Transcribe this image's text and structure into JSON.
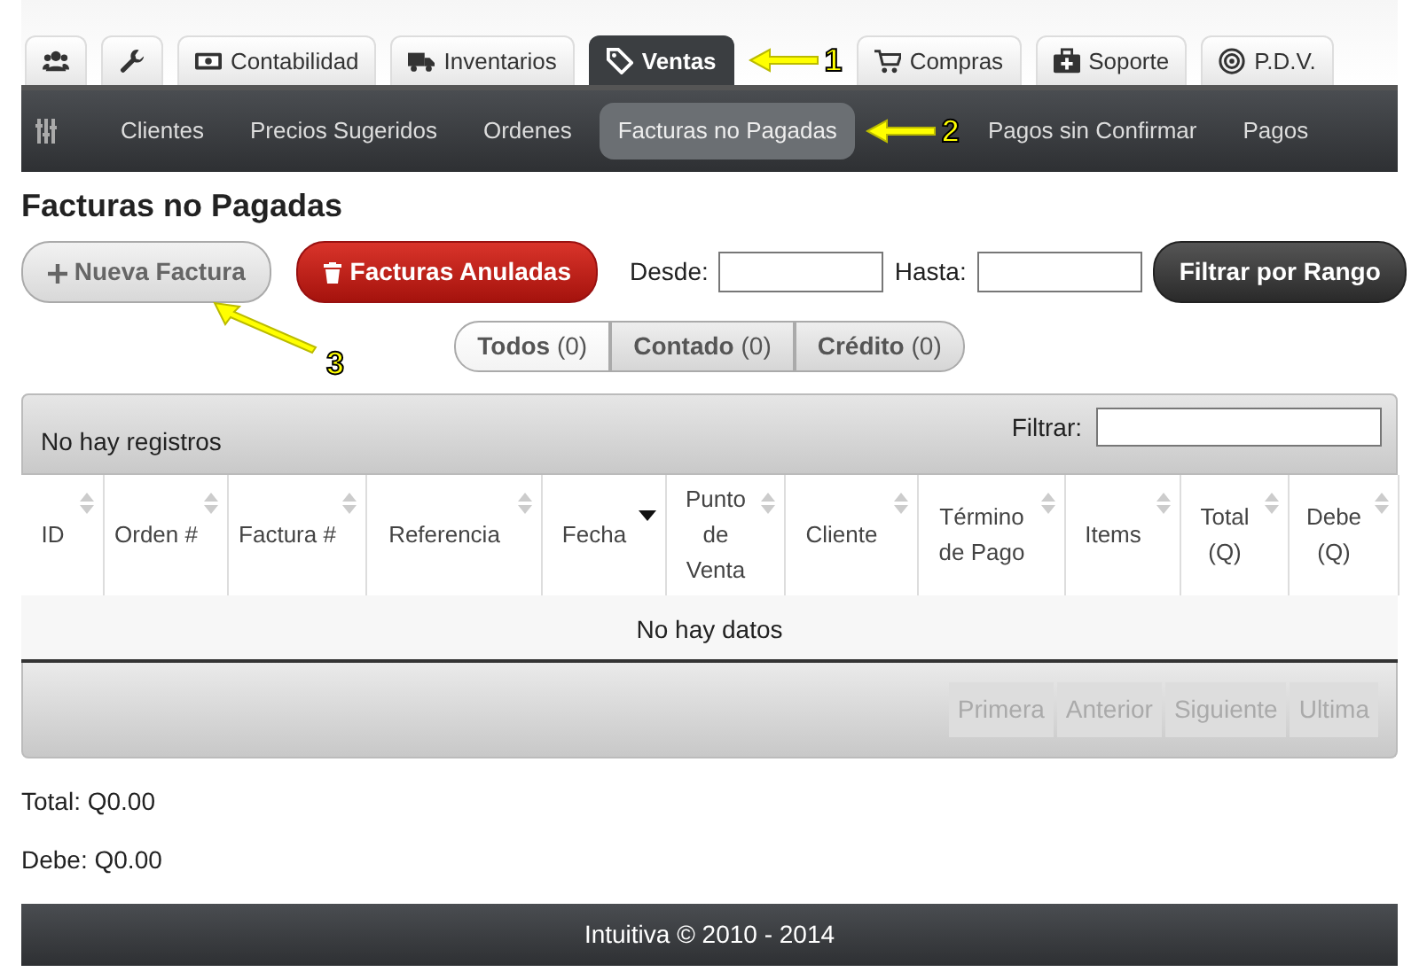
{
  "main_tabs": [
    {
      "selected": false
    },
    {
      "selected": false
    },
    {
      "label": "Contabilidad",
      "selected": false
    },
    {
      "label": "Inventarios",
      "selected": false
    },
    {
      "label": "Ventas",
      "selected": true
    },
    {
      "label": "Compras",
      "selected": false
    },
    {
      "label": "Soporte",
      "selected": false
    },
    {
      "label": "P.D.V.",
      "selected": false
    }
  ],
  "sub_nav": [
    {
      "label": "Clientes",
      "selected": false
    },
    {
      "label": "Precios Sugeridos",
      "selected": false
    },
    {
      "label": "Ordenes",
      "selected": false
    },
    {
      "label": "Facturas no Pagadas",
      "selected": true
    },
    {
      "label": "Pagos sin Confirmar",
      "selected": false
    },
    {
      "label": "Pagos",
      "selected": false
    }
  ],
  "page_title": "Facturas no Pagadas",
  "toolbar": {
    "new_button": "Nueva Factura",
    "cancelled_button": "Facturas Anuladas",
    "from_label": "Desde:",
    "to_label": "Hasta:",
    "filter_button": "Filtrar por Rango"
  },
  "segments": [
    {
      "label": "**Todos** (0)",
      "selected": true
    },
    {
      "label": "**Contado** (0)",
      "selected": false
    },
    {
      "label": "**Crédito** (0)",
      "selected": false
    }
  ],
  "table": {
    "info": "No hay registros",
    "filter_label": "Filtrar:",
    "columns": [
      {
        "label": "ID",
        "sorted": false
      },
      {
        "label": "Orden #",
        "sorted": false
      },
      {
        "label": "Factura #",
        "sorted": false
      },
      {
        "label": "Referencia",
        "sorted": false
      },
      {
        "label": "Fecha",
        "sorted": true
      },
      {
        "label": "Punto de Venta",
        "sorted": false
      },
      {
        "label": "Cliente",
        "sorted": false
      },
      {
        "label": "Término de Pago",
        "sorted": false
      },
      {
        "label": "Items",
        "sorted": false
      },
      {
        "label": "Total (Q)",
        "sorted": false
      },
      {
        "label": "Debe (Q)",
        "sorted": false
      }
    ],
    "empty_text": "No hay datos",
    "pager": [
      {
        "label": "Primera",
        "disabled": true
      },
      {
        "label": "Anterior",
        "disabled": true
      },
      {
        "label": "Siguiente",
        "disabled": true
      },
      {
        "label": "Ultima",
        "disabled": true
      }
    ]
  },
  "totals": [
    "Total: Q0.00",
    "Debe: Q0.00"
  ],
  "footer": "Intuitiva © 2010 - 2014",
  "callouts": [
    {
      "number": "1"
    },
    {
      "number": "2"
    },
    {
      "number": "3"
    }
  ]
}
